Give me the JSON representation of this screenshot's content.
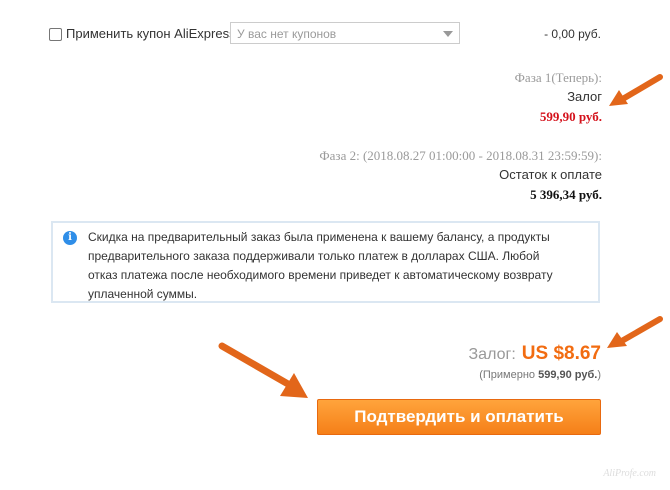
{
  "coupon": {
    "checkbox_checked": false,
    "label": "Применить купон AliExpress:",
    "select_value": "У вас нет купонов",
    "amount": "- 0,00 руб."
  },
  "phase1": {
    "title": "Фаза 1(Теперь):",
    "label": "Залог",
    "amount": "599,90 руб."
  },
  "phase2": {
    "title": "Фаза 2: (2018.08.27 01:00:00 - 2018.08.31 23:59:59):",
    "label": "Остаток к оплате",
    "amount": "5 396,34 руб."
  },
  "notice": {
    "icon": "info-icon",
    "text": "Скидка на предварительный заказ была применена к вашему балансу, а продукты предварительного заказа поддерживали только платеж в долларах США. Любой отказ платежа после необходимого времени приведет к автоматическому возврату уплаченной суммы."
  },
  "deposit": {
    "label": "Залог:",
    "amount": "US $8.67",
    "approx_prefix": "(Примерно ",
    "approx_value": "599,90 руб.",
    "approx_suffix": ")"
  },
  "confirm_button": {
    "label": "Подтвердить и оплатить"
  },
  "watermark": "AliProfe.com",
  "colors": {
    "accent_orange": "#f26c11",
    "price_red": "#d4111b",
    "button_orange": "#f57f18",
    "arrow": "#e2661a",
    "notice_border": "#dbe7f2",
    "info_blue": "#2f8ee8"
  }
}
